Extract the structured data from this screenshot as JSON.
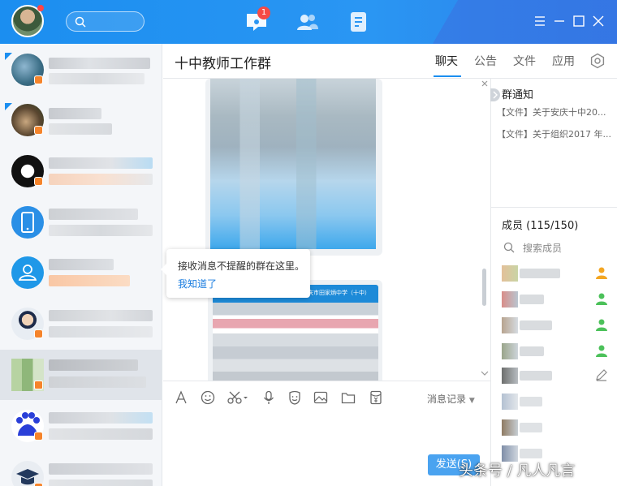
{
  "header": {
    "unread_badge": "1",
    "icons": [
      "message-icon",
      "contacts-icon",
      "apps-icon",
      "menu-icon",
      "maximize-icon",
      "close-icon"
    ]
  },
  "chat": {
    "title": "十中教师工作群",
    "tabs": [
      "聊天",
      "公告",
      "文件",
      "应用"
    ],
    "active_tab": "聊天"
  },
  "tooltip": {
    "message": "接收消息不提醒的群在这里。",
    "action": "我知道了"
  },
  "toolbar": {
    "history_label": "消息记录",
    "send_label": "发送(S)"
  },
  "notice": {
    "title": "群通知",
    "items": [
      "【文件】关于安庆十中20...",
      "【文件】关于组织2017 年..."
    ]
  },
  "members": {
    "title": "成员 (115/150)",
    "search_placeholder": "搜索成员"
  },
  "image_caption": "安庆市田家炳中学（十中）",
  "watermark": "头条号 / 凡人凡言",
  "colors": {
    "accent": "#1b8ef0",
    "mute_badge": "#f5842b",
    "link": "#1b7ee0"
  }
}
